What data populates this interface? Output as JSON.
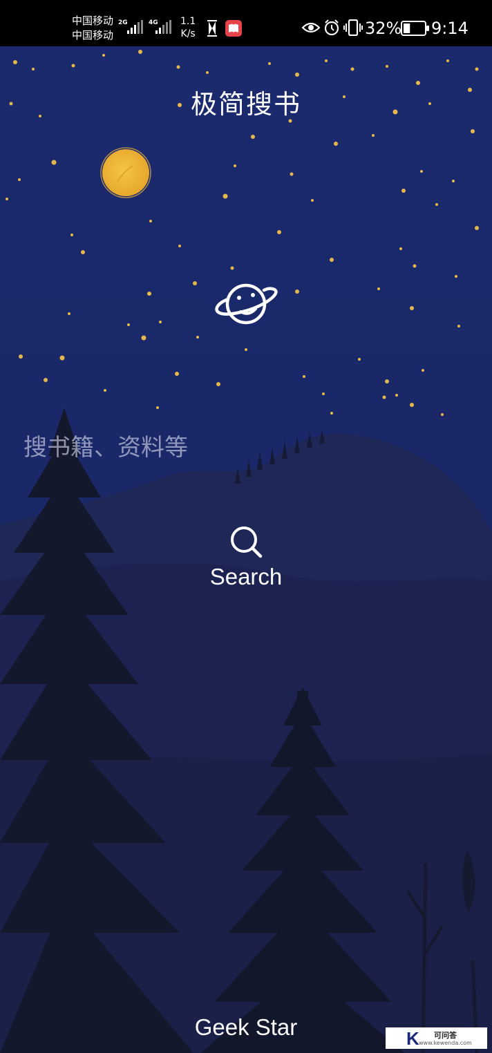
{
  "status_bar": {
    "carrier_1": "中国移动",
    "carrier_2": "中国移动",
    "network_1": "2G",
    "network_2": "4G",
    "speed_value": "1.1",
    "speed_unit": "K/s",
    "battery_text": "32%",
    "battery_level": 0.32,
    "time": "9:14",
    "icons": [
      "signal-icon",
      "hourglass-icon",
      "book-app-icon",
      "eye-icon",
      "alarm-icon",
      "vibrate-icon",
      "battery-icon"
    ]
  },
  "app": {
    "title": "极简搜书",
    "logo_icon": "planet-icon"
  },
  "search": {
    "placeholder": "搜书籍、资料等",
    "value": "",
    "button_label": "Search",
    "button_icon": "search-icon"
  },
  "footer": {
    "text": "Geek Star"
  },
  "watermark": {
    "logo_letter": "K",
    "text_cn": "可问答",
    "url": "www.kewenda.com"
  },
  "colors": {
    "sky": "#1b2766",
    "status_bar": "#000000",
    "moon": "#f2b53a",
    "star": "#e8b84a",
    "mountain": "#1e2552",
    "tree": "#141829",
    "text": "#ffffff"
  }
}
